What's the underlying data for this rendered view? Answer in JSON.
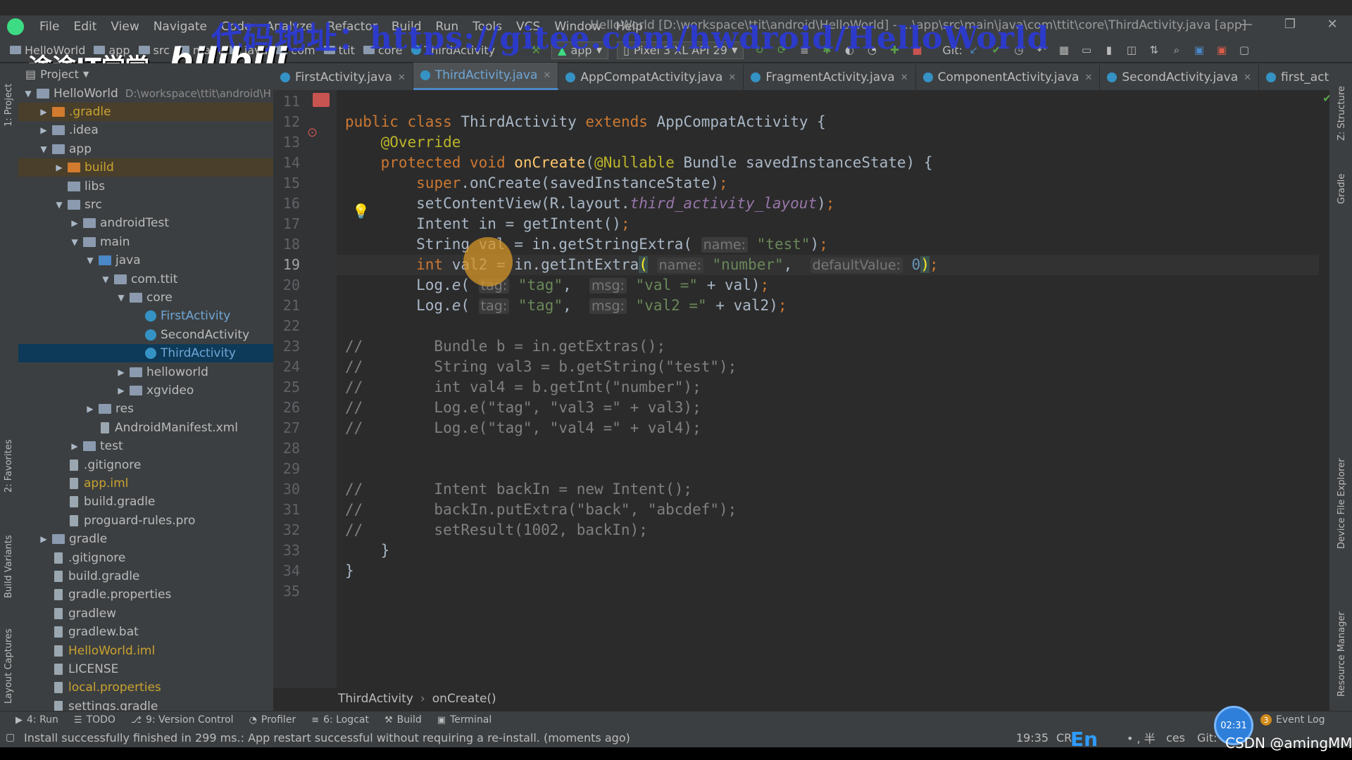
{
  "window": {
    "title": "HelloWorld [D:\\workspace\\ttit\\android\\HelloWorld] - ...\\app\\src\\main\\java\\com\\ttit\\core\\ThirdActivity.java [app]",
    "menu": [
      "File",
      "Edit",
      "View",
      "Navigate",
      "Code",
      "Analyze",
      "Refactor",
      "Build",
      "Run",
      "Tools",
      "VCS",
      "Window",
      "Help"
    ],
    "controls": {
      "minimize": "—",
      "restore": "❐",
      "close": "✕"
    }
  },
  "watermark": {
    "url_text": "代码地址：https://gitee.com/hwdroid/HelloWorld",
    "school": "途途IT学堂",
    "site": "bilibili",
    "csdn": "CSDN @amingMM"
  },
  "navbar": {
    "crumbs": [
      "HelloWorld",
      "app",
      "src",
      "main",
      "java",
      "com",
      "ttit",
      "core",
      "ThirdActivity"
    ],
    "run_config": "app",
    "device": "Pixel 3 XL API 29",
    "git_label": "Git:"
  },
  "tabs": [
    {
      "label": "FirstActivity.java",
      "active": false
    },
    {
      "label": "ThirdActivity.java",
      "active": true
    },
    {
      "label": "AppCompatActivity.java",
      "active": false
    },
    {
      "label": "FragmentActivity.java",
      "active": false
    },
    {
      "label": "ComponentActivity.java",
      "active": false
    },
    {
      "label": "SecondActivity.java",
      "active": false
    },
    {
      "label": "first_activity_layout",
      "active": false
    }
  ],
  "left_strip": [
    "1: Project",
    "2: Favorites",
    "Build Variants",
    "Layout Captures"
  ],
  "right_strip": [
    "Z: Structure",
    "Gradle",
    "Device File Explorer",
    "Resource Manager"
  ],
  "project": {
    "header": "Project",
    "root_label": "HelloWorld",
    "root_path": "D:\\workspace\\ttit\\android\\H",
    "rows": [
      {
        "label": ".gradle",
        "depth": 1,
        "arrow": "▶",
        "icon": "folder-orange",
        "style": "highlight"
      },
      {
        "label": ".idea",
        "depth": 1,
        "arrow": "▶",
        "icon": "folder",
        "style": ""
      },
      {
        "label": "app",
        "depth": 1,
        "arrow": "▼",
        "icon": "folder",
        "style": ""
      },
      {
        "label": "build",
        "depth": 2,
        "arrow": "▶",
        "icon": "folder-orange",
        "style": "highlight"
      },
      {
        "label": "libs",
        "depth": 2,
        "arrow": "",
        "icon": "folder",
        "style": ""
      },
      {
        "label": "src",
        "depth": 2,
        "arrow": "▼",
        "icon": "folder",
        "style": ""
      },
      {
        "label": "androidTest",
        "depth": 3,
        "arrow": "▶",
        "icon": "folder",
        "style": ""
      },
      {
        "label": "main",
        "depth": 3,
        "arrow": "▼",
        "icon": "folder",
        "style": ""
      },
      {
        "label": "java",
        "depth": 4,
        "arrow": "▼",
        "icon": "folder-blue",
        "style": ""
      },
      {
        "label": "com.ttit",
        "depth": 5,
        "arrow": "▼",
        "icon": "folder",
        "style": ""
      },
      {
        "label": "core",
        "depth": 6,
        "arrow": "▼",
        "icon": "folder",
        "style": ""
      },
      {
        "label": "FirstActivity",
        "depth": 7,
        "arrow": "",
        "icon": "class",
        "style": "blue"
      },
      {
        "label": "SecondActivity",
        "depth": 7,
        "arrow": "",
        "icon": "class",
        "style": ""
      },
      {
        "label": "ThirdActivity",
        "depth": 7,
        "arrow": "",
        "icon": "class",
        "style": "selected"
      },
      {
        "label": "helloworld",
        "depth": 6,
        "arrow": "▶",
        "icon": "folder",
        "style": ""
      },
      {
        "label": "xgvideo",
        "depth": 6,
        "arrow": "▶",
        "icon": "folder",
        "style": ""
      },
      {
        "label": "res",
        "depth": 4,
        "arrow": "▶",
        "icon": "folder",
        "style": ""
      },
      {
        "label": "AndroidManifest.xml",
        "depth": 4,
        "arrow": "",
        "icon": "file",
        "style": ""
      },
      {
        "label": "test",
        "depth": 3,
        "arrow": "▶",
        "icon": "folder",
        "style": ""
      },
      {
        "label": ".gitignore",
        "depth": 2,
        "arrow": "",
        "icon": "file",
        "style": ""
      },
      {
        "label": "app.iml",
        "depth": 2,
        "arrow": "",
        "icon": "file",
        "style": "yellow"
      },
      {
        "label": "build.gradle",
        "depth": 2,
        "arrow": "",
        "icon": "file",
        "style": ""
      },
      {
        "label": "proguard-rules.pro",
        "depth": 2,
        "arrow": "",
        "icon": "file",
        "style": ""
      },
      {
        "label": "gradle",
        "depth": 1,
        "arrow": "▶",
        "icon": "folder",
        "style": ""
      },
      {
        "label": ".gitignore",
        "depth": 1,
        "arrow": "",
        "icon": "file",
        "style": ""
      },
      {
        "label": "build.gradle",
        "depth": 1,
        "arrow": "",
        "icon": "file",
        "style": ""
      },
      {
        "label": "gradle.properties",
        "depth": 1,
        "arrow": "",
        "icon": "file",
        "style": ""
      },
      {
        "label": "gradlew",
        "depth": 1,
        "arrow": "",
        "icon": "file",
        "style": ""
      },
      {
        "label": "gradlew.bat",
        "depth": 1,
        "arrow": "",
        "icon": "file",
        "style": ""
      },
      {
        "label": "HelloWorld.iml",
        "depth": 1,
        "arrow": "",
        "icon": "file",
        "style": "yellow"
      },
      {
        "label": "LICENSE",
        "depth": 1,
        "arrow": "",
        "icon": "file",
        "style": ""
      },
      {
        "label": "local.properties",
        "depth": 1,
        "arrow": "",
        "icon": "file",
        "style": "yellow"
      },
      {
        "label": "settings.gradle",
        "depth": 1,
        "arrow": "",
        "icon": "file",
        "style": ""
      }
    ]
  },
  "editor": {
    "current_line": 19,
    "lines": [
      {
        "n": 11,
        "tokens": []
      },
      {
        "n": 12,
        "tokens": [
          [
            "kw",
            "public class "
          ],
          [
            "",
            "ThirdActivity "
          ],
          [
            "kw",
            "extends "
          ],
          [
            "",
            "AppCompatActivity {"
          ]
        ]
      },
      {
        "n": 13,
        "tokens": [
          [
            "",
            "    "
          ],
          [
            "ann",
            "@Override"
          ]
        ]
      },
      {
        "n": 14,
        "tokens": [
          [
            "",
            "    "
          ],
          [
            "kw",
            "protected void "
          ],
          [
            "fn",
            "onCreate"
          ],
          [
            "",
            "("
          ],
          [
            "ann",
            "@Nullable "
          ],
          [
            "",
            "Bundle savedInstanceState) {"
          ]
        ]
      },
      {
        "n": 15,
        "tokens": [
          [
            "",
            "        "
          ],
          [
            "kw",
            "super"
          ],
          [
            "",
            ".onCreate(savedInstanceState)"
          ],
          [
            "kw",
            ";"
          ]
        ]
      },
      {
        "n": 16,
        "tokens": [
          [
            "",
            "        setContentView(R.layout."
          ],
          [
            "field",
            "third_activity_layout"
          ],
          [
            "",
            ")"
          ],
          [
            "kw",
            ";"
          ]
        ]
      },
      {
        "n": 17,
        "tokens": [
          [
            "",
            "        Intent in = getIntent()"
          ],
          [
            "kw",
            ";"
          ]
        ]
      },
      {
        "n": 18,
        "tokens": [
          [
            "",
            "        String val = in.getStringExtra( "
          ],
          [
            "hint",
            "name:"
          ],
          [
            "str",
            " \"test\""
          ],
          [
            "",
            ")"
          ],
          [
            "kw",
            ";"
          ]
        ]
      },
      {
        "n": 19,
        "tokens": [
          [
            "",
            "        "
          ],
          [
            "kw",
            "int "
          ],
          [
            "",
            "val2 = in.getIntExtra"
          ],
          [
            "bracket",
            "("
          ],
          [
            "",
            " "
          ],
          [
            "hint",
            "name:"
          ],
          [
            "str",
            " \"number\""
          ],
          [
            "",
            ",  "
          ],
          [
            "hint",
            "defaultValue:"
          ],
          [
            "num",
            " 0"
          ],
          [
            "bracket",
            ")"
          ],
          [
            "kw",
            ";"
          ]
        ]
      },
      {
        "n": 20,
        "tokens": [
          [
            "",
            "        Log."
          ],
          [
            "italic",
            "e"
          ],
          [
            "",
            "( "
          ],
          [
            "hint",
            "tag:"
          ],
          [
            "str",
            " \"tag\""
          ],
          [
            "",
            ",  "
          ],
          [
            "hint",
            "msg:"
          ],
          [
            "str",
            " \"val =\" "
          ],
          [
            "",
            "+ val)"
          ],
          [
            "kw",
            ";"
          ]
        ]
      },
      {
        "n": 21,
        "tokens": [
          [
            "",
            "        Log."
          ],
          [
            "italic",
            "e"
          ],
          [
            "",
            "( "
          ],
          [
            "hint",
            "tag:"
          ],
          [
            "str",
            " \"tag\""
          ],
          [
            "",
            ",  "
          ],
          [
            "hint",
            "msg:"
          ],
          [
            "str",
            " \"val2 =\" "
          ],
          [
            "",
            "+ val2)"
          ],
          [
            "kw",
            ";"
          ]
        ]
      },
      {
        "n": 22,
        "tokens": []
      },
      {
        "n": 23,
        "tokens": [
          [
            "cmt",
            "//        Bundle b = in.getExtras();"
          ]
        ]
      },
      {
        "n": 24,
        "tokens": [
          [
            "cmt",
            "//        String val3 = b.getString(\"test\");"
          ]
        ]
      },
      {
        "n": 25,
        "tokens": [
          [
            "cmt",
            "//        int val4 = b.getInt(\"number\");"
          ]
        ]
      },
      {
        "n": 26,
        "tokens": [
          [
            "cmt",
            "//        Log.e(\"tag\", \"val3 =\" + val3);"
          ]
        ]
      },
      {
        "n": 27,
        "tokens": [
          [
            "cmt",
            "//        Log.e(\"tag\", \"val4 =\" + val4);"
          ]
        ]
      },
      {
        "n": 28,
        "tokens": []
      },
      {
        "n": 29,
        "tokens": []
      },
      {
        "n": 30,
        "tokens": [
          [
            "cmt",
            "//        Intent backIn = new Intent();"
          ]
        ]
      },
      {
        "n": 31,
        "tokens": [
          [
            "cmt",
            "//        backIn.putExtra(\"back\", \"abcdef\");"
          ]
        ]
      },
      {
        "n": 32,
        "tokens": [
          [
            "cmt",
            "//        setResult(1002, backIn);"
          ]
        ]
      },
      {
        "n": 33,
        "tokens": [
          [
            "",
            "    }"
          ]
        ]
      },
      {
        "n": 34,
        "tokens": [
          [
            "",
            "}"
          ]
        ]
      },
      {
        "n": 35,
        "tokens": []
      }
    ],
    "crumbs": [
      "ThirdActivity",
      "onCreate()"
    ]
  },
  "toolwindows": [
    {
      "icon": "▶",
      "label": "4: Run"
    },
    {
      "icon": "☰",
      "label": "TODO"
    },
    {
      "icon": "⎇",
      "label": "9: Version Control"
    },
    {
      "icon": "◔",
      "label": "Profiler"
    },
    {
      "icon": "≡",
      "label": "6: Logcat"
    },
    {
      "icon": "⚒",
      "label": "Build"
    },
    {
      "icon": "▣",
      "label": "Terminal"
    }
  ],
  "event_log": {
    "count": "3",
    "label": "Event Log"
  },
  "status": {
    "message": "Install successfully finished in 299 ms.: App restart successful without requiring a re-install. (moments ago)",
    "position": "19:35",
    "encoding": "CR",
    "ime": "En",
    "ime_extra": "• , 半",
    "git": "Git:",
    "clock": "02:31",
    "right_partial": "ces"
  },
  "colors": {
    "keyword": "#cc7832",
    "annotation": "#bbb529",
    "method": "#ffc66d",
    "string": "#6a8759",
    "number": "#6897bb",
    "comment": "#808080",
    "field": "#9876aa"
  }
}
